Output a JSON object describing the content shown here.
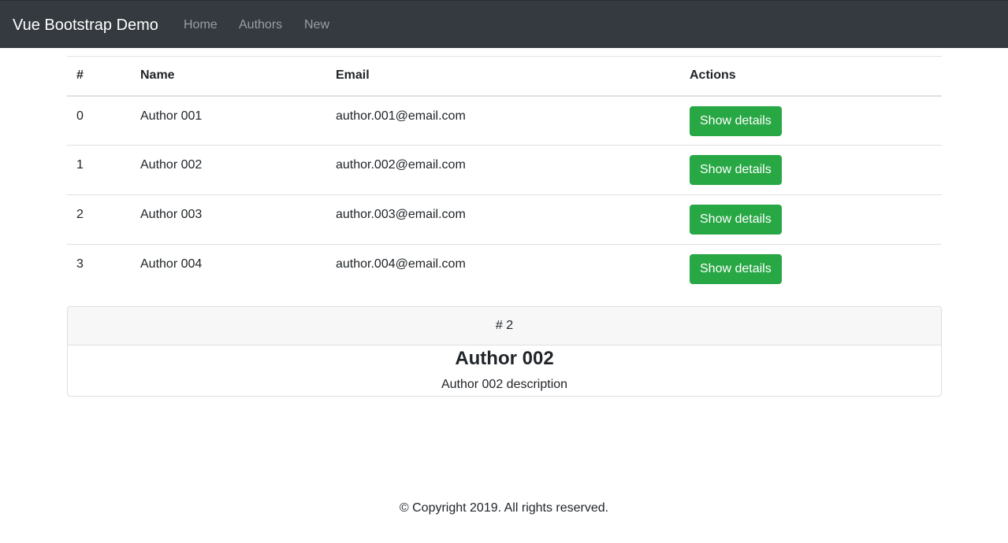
{
  "navbar": {
    "brand": "Vue Bootstrap Demo",
    "links": [
      "Home",
      "Authors",
      "New"
    ]
  },
  "table": {
    "headers": [
      "#",
      "Name",
      "Email",
      "Actions"
    ],
    "rows": [
      {
        "index": "0",
        "name": "Author 001",
        "email": "author.001@email.com",
        "action": "Show details"
      },
      {
        "index": "1",
        "name": "Author 002",
        "email": "author.002@email.com",
        "action": "Show details"
      },
      {
        "index": "2",
        "name": "Author 003",
        "email": "author.003@email.com",
        "action": "Show details"
      },
      {
        "index": "3",
        "name": "Author 004",
        "email": "author.004@email.com",
        "action": "Show details"
      }
    ]
  },
  "detail_card": {
    "header": "# 2",
    "title": "Author 002",
    "description": "Author 002 description"
  },
  "footer": {
    "copyright": "© Copyright 2019. All rights reserved."
  },
  "colors": {
    "navbar_bg": "#343a40",
    "button_bg": "#28a745"
  }
}
